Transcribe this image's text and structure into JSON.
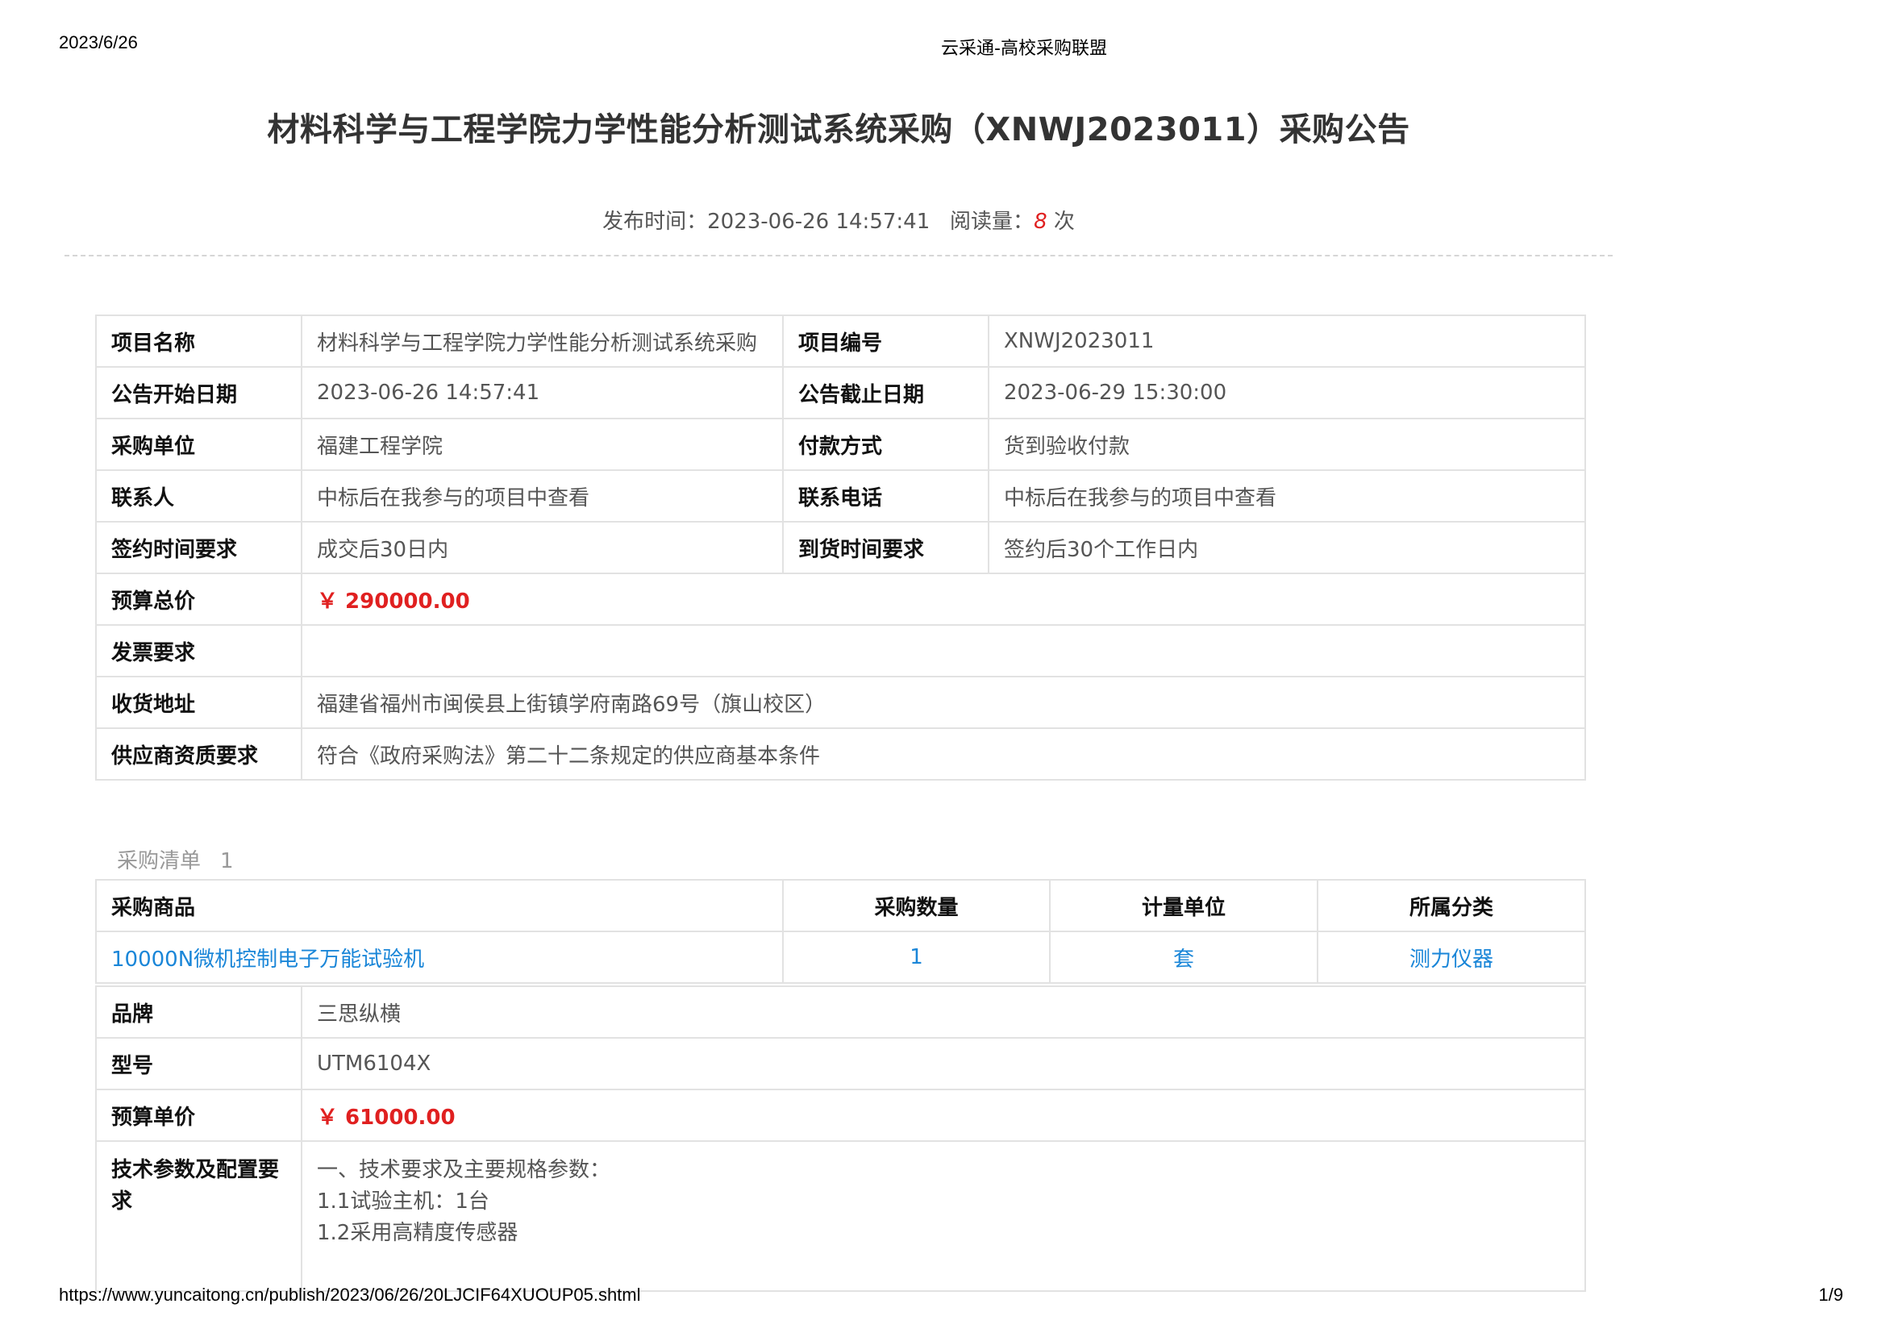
{
  "print_header": {
    "date": "2023/6/26",
    "site_title": "云采通-高校采购联盟"
  },
  "print_footer": {
    "url": "https://www.yuncaitong.cn/publish/2023/06/26/20LJCIF64XUOUP05.shtml",
    "page": "1/9"
  },
  "title": "材料科学与工程学院力学性能分析测试系统采购（XNWJ2023011）采购公告",
  "meta": {
    "publish_label": "发布时间：",
    "publish_time": "2023-06-26 14:57:41",
    "read_label": "阅读量：",
    "read_count": "8",
    "read_unit": "次"
  },
  "info": {
    "project_name_label": "项目名称",
    "project_name": "材料科学与工程学院力学性能分析测试系统采购",
    "project_no_label": "项目编号",
    "project_no": "XNWJ2023011",
    "start_label": "公告开始日期",
    "start": "2023-06-26 14:57:41",
    "end_label": "公告截止日期",
    "end": "2023-06-29 15:30:00",
    "buyer_label": "采购单位",
    "buyer": "福建工程学院",
    "payment_label": "付款方式",
    "payment": "货到验收付款",
    "contact_label": "联系人",
    "contact": "中标后在我参与的项目中查看",
    "phone_label": "联系电话",
    "phone": "中标后在我参与的项目中查看",
    "sign_label": "签约时间要求",
    "sign": "成交后30日内",
    "delivery_label": "到货时间要求",
    "delivery": "签约后30个工作日内",
    "budget_label": "预算总价",
    "budget": "￥ 290000.00",
    "invoice_label": "发票要求",
    "invoice": "",
    "address_label": "收货地址",
    "address": "福建省福州市闽侯县上街镇学府南路69号（旗山校区）",
    "qualification_label": "供应商资质要求",
    "qualification": "符合《政府采购法》第二十二条规定的供应商基本条件"
  },
  "list": {
    "caption": "采购清单",
    "count": "1"
  },
  "goods": {
    "headers": [
      "采购商品",
      "采购数量",
      "计量单位",
      "所属分类"
    ],
    "row": {
      "name": "10000N微机控制电子万能试验机",
      "qty": "1",
      "unit": "套",
      "category": "测力仪器"
    }
  },
  "detail": {
    "brand_label": "品牌",
    "brand": "三思纵横",
    "model_label": "型号",
    "model": "UTM6104X",
    "unit_price_label": "预算单价",
    "unit_price": "￥ 61000.00",
    "spec_label": "技术参数及配置要求",
    "spec_lines": [
      "一、技术要求及主要规格参数：",
      "1.1试验主机：1台",
      "1.2采用高精度传感器"
    ]
  }
}
